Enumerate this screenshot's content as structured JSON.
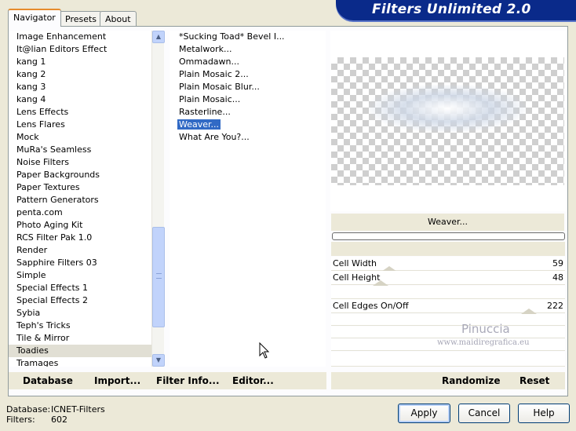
{
  "tabs": [
    "Navigator",
    "Presets",
    "About"
  ],
  "banner_title": "Filters Unlimited 2.0",
  "categories": [
    "Image Enhancement",
    "It@lian Editors Effect",
    "kang 1",
    "kang 2",
    "kang 3",
    "kang 4",
    "Lens Effects",
    "Lens Flares",
    "Mock",
    "MuRa's Seamless",
    "Noise Filters",
    "Paper Backgrounds",
    "Paper Textures",
    "Pattern Generators",
    "penta.com",
    "Photo Aging Kit",
    "RCS Filter Pak 1.0",
    "Render",
    "Sapphire Filters 03",
    "Simple",
    "Special Effects 1",
    "Special Effects 2",
    "Sybia",
    "Teph's Tricks",
    "Tile & Mirror",
    "Toadies",
    "Tramages"
  ],
  "selected_category": "Toadies",
  "filters": [
    "*Sucking Toad*  Bevel I...",
    "Metalwork...",
    "Ommadawn...",
    "Plain Mosaic 2...",
    "Plain Mosaic Blur...",
    "Plain Mosaic...",
    "Rasterline...",
    "Weaver...",
    "What Are You?..."
  ],
  "selected_filter": "Weaver...",
  "filter_title": "Weaver...",
  "params": [
    {
      "label": "Cell Width",
      "value": "59",
      "level": 0.23
    },
    {
      "label": "Cell Height",
      "value": "48",
      "level": 0.19
    },
    {
      "label": "Cell Edges On/Off",
      "value": "222",
      "level": 0.87
    }
  ],
  "watermark": {
    "line1": "Pinuccia",
    "line2": "www.maidiregrafica.eu"
  },
  "toolbar": {
    "database": "Database",
    "import": "Import...",
    "filter_info": "Filter Info...",
    "editor": "Editor...",
    "randomize": "Randomize",
    "reset": "Reset"
  },
  "info": {
    "database_label": "Database:",
    "database_value": "ICNET-Filters",
    "filters_label": "Filters:",
    "filters_value": "602"
  },
  "buttons": {
    "apply": "Apply",
    "cancel": "Cancel",
    "help": "Help"
  },
  "icons": {
    "scroll_up": "chevron-up-icon",
    "scroll_down": "chevron-down-icon",
    "cursor": "mouse-pointer-icon"
  }
}
